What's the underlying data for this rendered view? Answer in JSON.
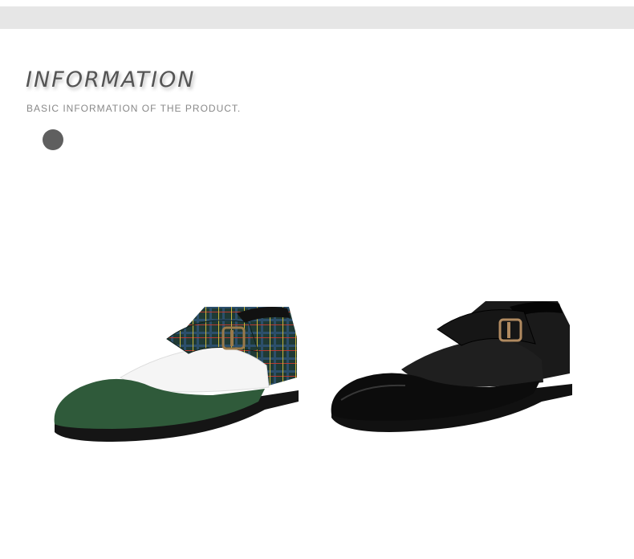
{
  "header": {
    "title": "INFORMATION",
    "subtitle": "BASIC INFORMATION OF THE PRODUCT."
  },
  "colors": {
    "top_bar": "#e6e6e6",
    "title_text": "#555555",
    "subtitle_text": "#888888",
    "dot": "#5f5f5f"
  },
  "products": [
    {
      "image_name": "green-white-plaid-monk-strap-shoe"
    },
    {
      "image_name": "black-monk-strap-shoe"
    }
  ]
}
